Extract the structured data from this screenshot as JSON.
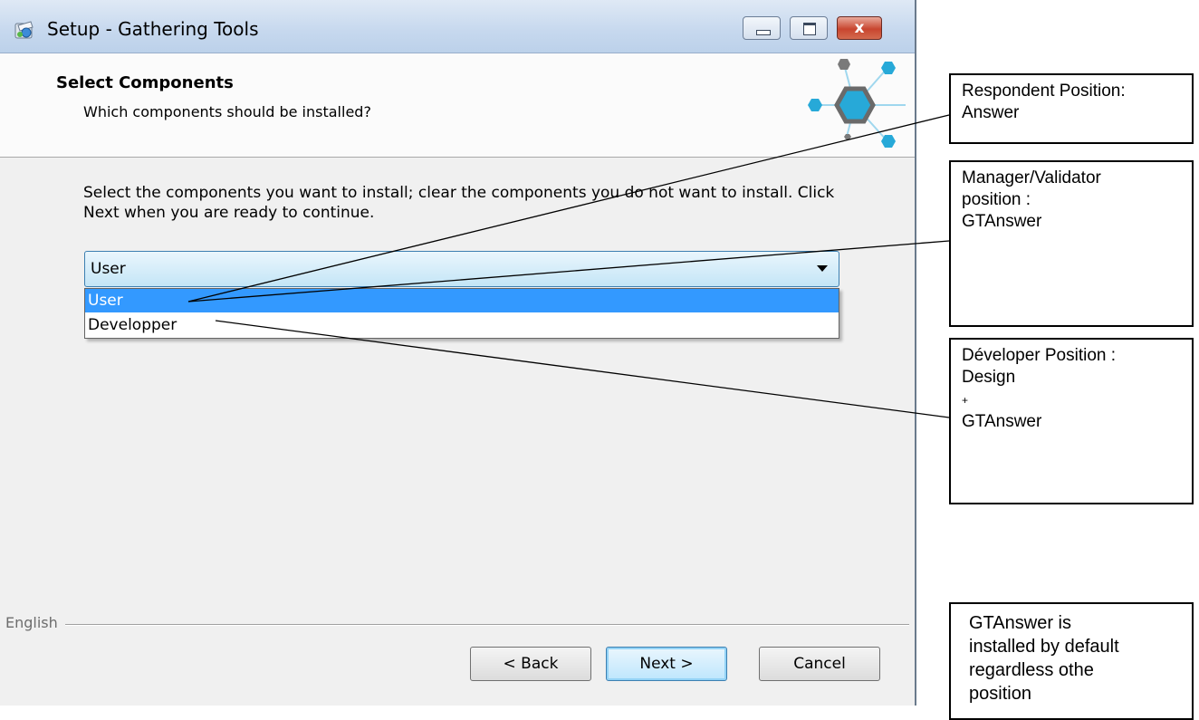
{
  "window": {
    "title": "Setup - Gathering Tools",
    "close_glyph": "x"
  },
  "header": {
    "title": "Select Components",
    "subtitle": "Which components should be installed?"
  },
  "instructions": "Select the components you want to install; clear the components you do not want to install. Click Next when you are ready to continue.",
  "components_select": {
    "value": "User",
    "options": [
      "User",
      "Developper"
    ],
    "highlighted_option": "User"
  },
  "footer": {
    "language_label": "English",
    "back_label": "< Back",
    "next_label": "Next >",
    "cancel_label": "Cancel"
  },
  "annotations": {
    "respondent": "Respondent Position:\nAnswer",
    "manager": "Manager/Validator\nposition :\nGTAnswer",
    "developer_line1": "Déveloper Position :\nDesign",
    "developer_plus": "+",
    "developer_line2": "GTAnswer",
    "default_note": "GTAnswer is\ninstalled by default\nregardless othe\nposition"
  },
  "colors": {
    "selection": "#3399ff",
    "logo_hex": "#27a9d8",
    "logo_dark": "#7a7a7a"
  },
  "icons": [
    "app-installer-icon",
    "minimize-icon",
    "maximize-icon",
    "close-icon",
    "hexagon-logo",
    "dropdown-arrow-icon"
  ]
}
